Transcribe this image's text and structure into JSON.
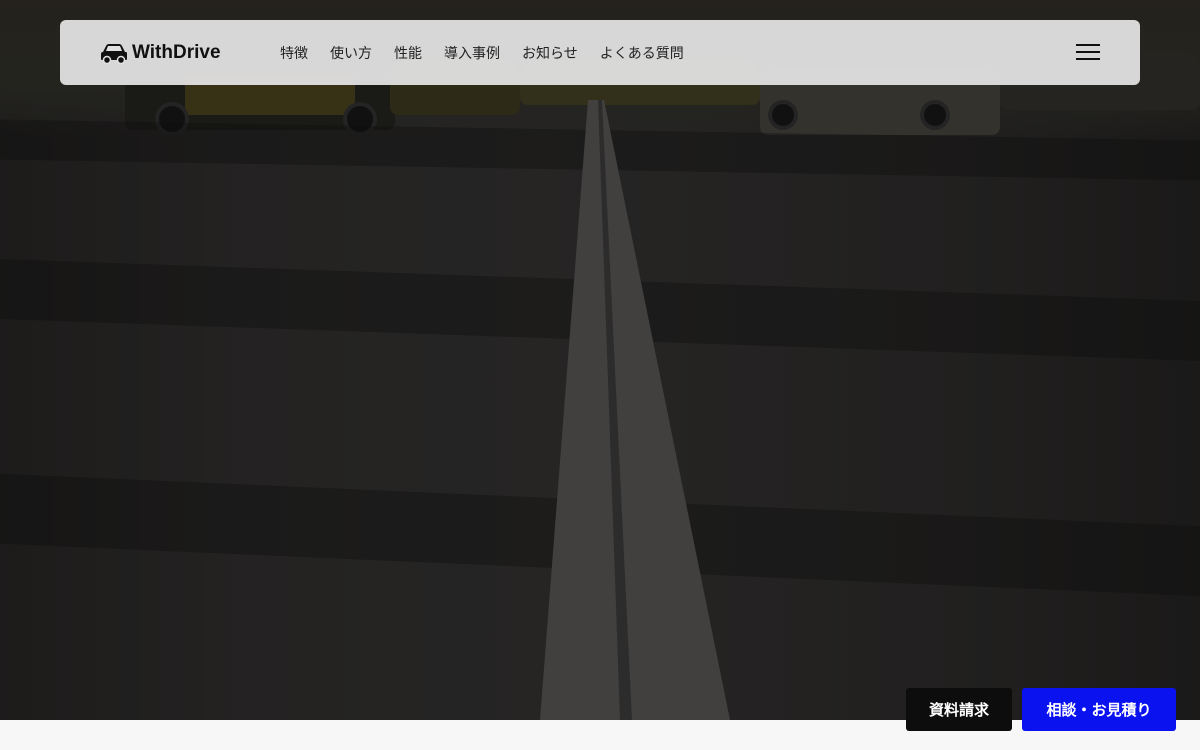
{
  "brand": {
    "name": "WithDrive",
    "logo_icon": "car-icon"
  },
  "nav": {
    "items": [
      {
        "label": "特徴"
      },
      {
        "label": "使い方"
      },
      {
        "label": "性能"
      },
      {
        "label": "導入事例"
      },
      {
        "label": "お知らせ"
      },
      {
        "label": "よくある質問"
      }
    ],
    "menu_icon": "hamburger-menu-icon"
  },
  "cta": {
    "documents_label": "資料請求",
    "consult_label": "相談・お見積り"
  },
  "colors": {
    "navbar_bg": "#e1e1e1",
    "cta_documents_bg": "#0d0d0d",
    "cta_consult_bg": "#0a12f0",
    "text": "#111111"
  }
}
